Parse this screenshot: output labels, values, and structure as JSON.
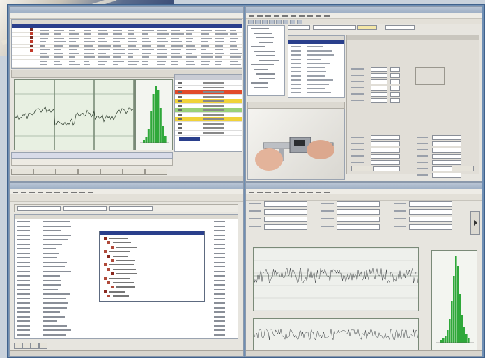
{
  "screens": [
    {
      "id": "top-left",
      "title": "",
      "tabs": [
        "",
        "",
        "",
        "",
        "",
        "",
        ""
      ],
      "status": ""
    },
    {
      "id": "top-right",
      "title": "",
      "menu": [
        "",
        "",
        "",
        "",
        "",
        "",
        "",
        "",
        "",
        ""
      ]
    },
    {
      "id": "bottom-left",
      "title": "",
      "menu": [
        "",
        "",
        "",
        "",
        "",
        "",
        "",
        "",
        "",
        ""
      ]
    },
    {
      "id": "bottom-right",
      "title": "",
      "menu": [
        "",
        "",
        "",
        "",
        "",
        "",
        "",
        "",
        "",
        ""
      ]
    }
  ],
  "colors": {
    "frame": "#6f8fb4",
    "window": "#e7e5df",
    "selection": "#2a3f8c",
    "histogram": "#2fa83a",
    "highlight_red": "#e14b2a",
    "highlight_yellow": "#f0d23a",
    "highlight_green": "#9ad07a"
  },
  "icons": [
    "window-icon",
    "toolbar-icon",
    "chart-icon",
    "histogram-icon",
    "caliper-photo"
  ]
}
